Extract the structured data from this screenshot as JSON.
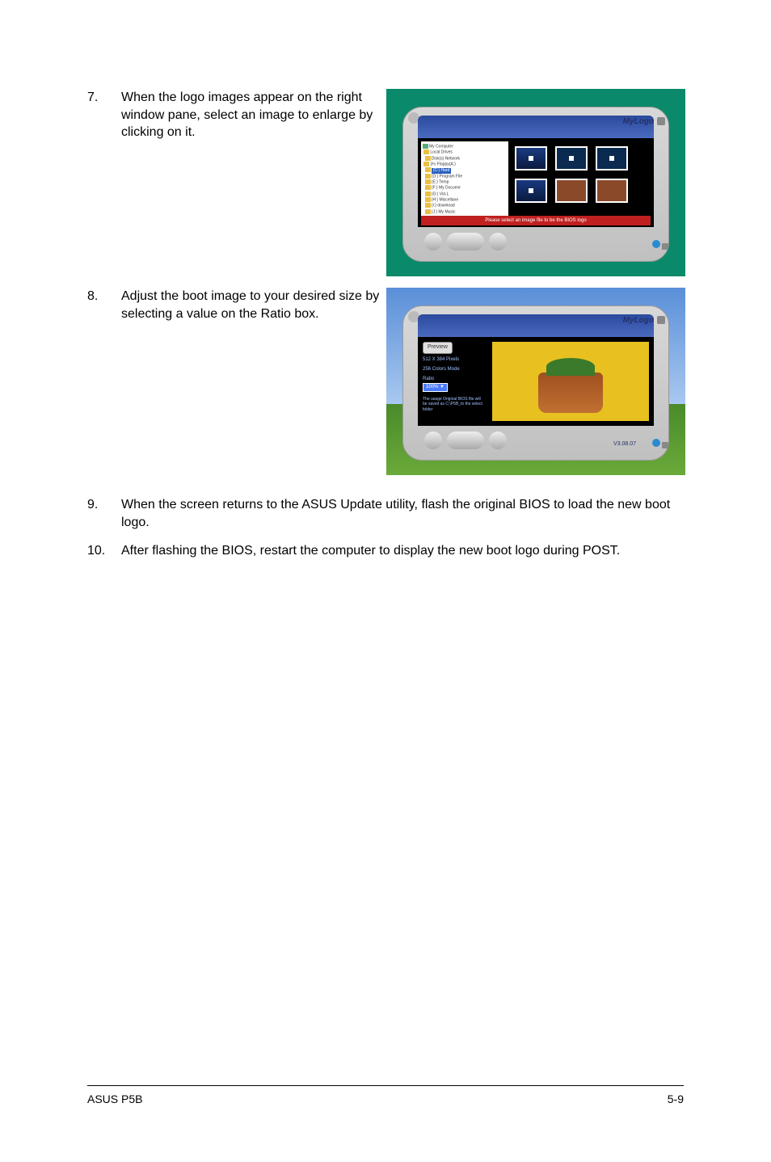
{
  "steps": {
    "s7": {
      "num": "7.",
      "text": "When the logo images appear on the right window pane, select an image to enlarge by clicking on it."
    },
    "s8": {
      "num": "8.",
      "text": "Adjust the boot image to your desired size by selecting a value on the Ratio box."
    },
    "s9": {
      "num": "9.",
      "text": "When the screen returns to the ASUS Update utility, flash the original BIOS to load the new boot logo."
    },
    "s10": {
      "num": "10.",
      "text": "After flashing the BIOS, restart the computer to display the new boot logo during POST."
    }
  },
  "screenshot1": {
    "brand": "MyLogo",
    "tree": [
      "My Computer",
      "Local Drives",
      "Disk(s) Network",
      "3½ Floppy(A:)",
      "(C:) Hard",
      "(D:) Program File",
      "(E:) Temp",
      "(F:) My Docume",
      "(G:) Vid-L",
      "(H:) Miscellane",
      "(I:) download",
      "(J:) My Music"
    ],
    "banner": "Please select an image file to be the BIOS logo"
  },
  "screenshot2": {
    "brand": "MyLogo",
    "preview_btn": "Preview",
    "line1": "512 X 384 Pixels",
    "line2": "256 Colors Mode",
    "ratio_label": "Ratio",
    "ratio_value": "100%",
    "note": "The usage Original BIOS file will be saved as C:\\P5B_to the select folder",
    "caption": "V3.08.07"
  },
  "footer": {
    "left": "ASUS P5B",
    "right": "5-9"
  }
}
